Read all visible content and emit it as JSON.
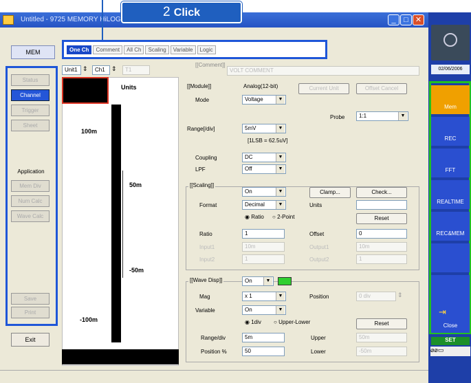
{
  "window": {
    "title": "Untitled - 9725 MEMORY HiLOGGER"
  },
  "callout": {
    "number": "2",
    "text": "Click"
  },
  "tabs": [
    {
      "label": "One Ch"
    },
    {
      "label": "Comment"
    },
    {
      "label": "All Ch"
    },
    {
      "label": "Scaling"
    },
    {
      "label": "Variable"
    },
    {
      "label": "Logic"
    }
  ],
  "left": {
    "mem": "MEM",
    "buttons": [
      "Status",
      "Channel",
      "Trigger",
      "Sheet"
    ],
    "application_label": "Application",
    "app_buttons": [
      "Mem Div",
      "Num Calc",
      "Wave Calc"
    ],
    "bottom_buttons": [
      "Save",
      "Print"
    ],
    "exit": "Exit"
  },
  "selectors": {
    "unit": "Unit1",
    "ch": "Ch1",
    "t": "T1"
  },
  "scale": {
    "units": "Units",
    "labels": [
      "100m",
      "50m",
      "-50m",
      "-100m"
    ]
  },
  "comment": {
    "label": "[[Comment]]",
    "value": "VOLT COMMENT"
  },
  "module": {
    "label": "[[Module]]",
    "value": "Analog(12-bit)",
    "current_unit": "Current Unit",
    "offset_cancel": "Offset Cancel",
    "mode_label": "Mode",
    "mode": "Voltage",
    "probe_label": "Probe",
    "probe": "1:1",
    "range_label": "Range[/div]",
    "range": "5mV",
    "lsb": "[1LSB = 62.5uV]",
    "coupling_label": "Coupling",
    "coupling": "DC",
    "lpf_label": "LPF",
    "lpf": "Off"
  },
  "scaling": {
    "label": "[[Scaling]]",
    "value": "On",
    "clamp": "Clamp...",
    "check": "Check...",
    "format_label": "Format",
    "format": "Decimal",
    "units_label": "Units",
    "units": "",
    "ratio_opt": "Ratio",
    "twopoint_opt": "2-Point",
    "reset": "Reset",
    "ratio_label": "Ratio",
    "ratio": "1",
    "offset_label": "Offset",
    "offset": "0",
    "input1_label": "Input1",
    "input1": "10m",
    "output1_label": "Output1",
    "output1": "10m",
    "input2_label": "Input2",
    "input2": "1",
    "output2_label": "Output2",
    "output2": "1"
  },
  "wave": {
    "label": "[[Wave Disp]]",
    "value": "On",
    "color": "#2fcf2f",
    "mag_label": "Mag",
    "mag": "x 1",
    "position_label": "Position",
    "position": "0 div",
    "variable_label": "Variable",
    "variable": "On",
    "div_opt": "1div",
    "ul_opt": "Upper-Lower",
    "reset": "Reset",
    "range_label": "Range/div",
    "range": "5m",
    "upper_label": "Upper",
    "upper": "50m",
    "pos_label": "Position %",
    "pos": "50",
    "lower_label": "Lower",
    "lower": "-50m"
  },
  "right": {
    "date": "02/06/2006",
    "buttons": [
      "Mem",
      "REC",
      "FFT",
      "REALTIME",
      "REC&MEM",
      "",
      ""
    ],
    "close": "Close",
    "set": "SET"
  }
}
